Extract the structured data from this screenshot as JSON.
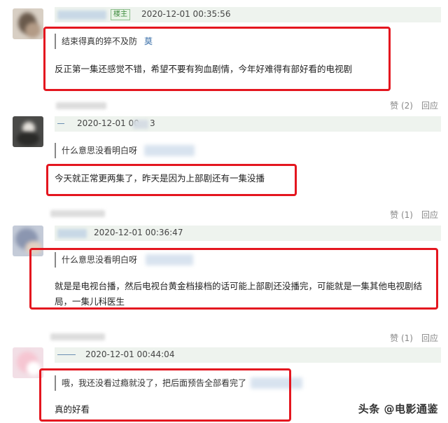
{
  "comments": [
    {
      "host_badge": "楼主",
      "timestamp": "2020-12-01 00:35:56",
      "quote_text": "结束得真的猝不及防",
      "quote_name": "莫",
      "reply_text": "反正第一集还感觉不错，希望不要有狗血剧情，今年好难得有部好看的电视剧",
      "likes": "赞 (2)",
      "reply_label": "回应"
    },
    {
      "timestamp": "2020-12-01 00.",
      "timestamp_tail": "3",
      "quote_text": "什么意思没看明白呀",
      "reply_text": "今天就正常更两集了，昨天是因为上部剧还有一集没播",
      "likes": "赞 (1)",
      "reply_label": "回应"
    },
    {
      "timestamp": "2020-12-01 00:36:47",
      "quote_text": "什么意思没看明白呀",
      "reply_line1": "就是是电视台播，然后电视台黄金档接档的话可能上部剧还没播完，可能就是一集其他电视剧结",
      "reply_line2": "局，一集儿科医生",
      "likes": "赞 (1)",
      "reply_label": "回应"
    },
    {
      "timestamp": "2020-12-01 00:44:04",
      "quote_text": "哦，我还没看过瘾就没了，把后面预告全部看完了",
      "reply_text": "真的好看",
      "likes": "赞 (1)",
      "reply_label": "回应"
    }
  ],
  "watermark": "头条 @电影通鉴",
  "colors": {
    "highlight_border": "#e4161f",
    "meta_bar_bg": "#eef3ee",
    "link_blue": "#3a6fa8",
    "muted_gray": "#888888"
  }
}
